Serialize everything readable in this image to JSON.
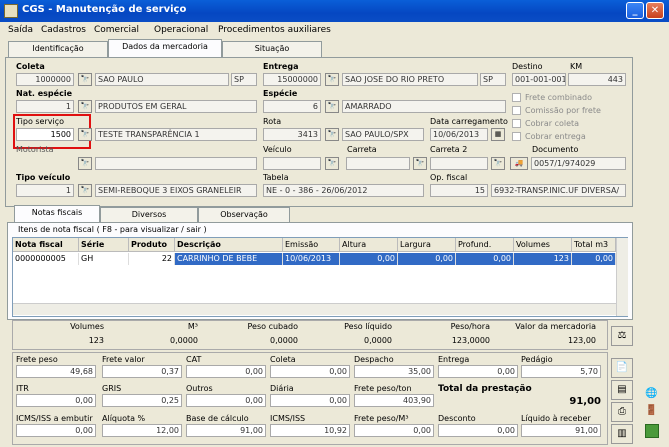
{
  "window": {
    "title": "CGS - Manutenção de serviço"
  },
  "menu": [
    "Saída",
    "Cadastros",
    "Comercial",
    "Operacional",
    "Procedimentos auxiliares"
  ],
  "top_tabs": [
    "Identificação",
    "Dados da mercadoria",
    "Situação"
  ],
  "top_tab_selected": "Dados da mercadoria",
  "coleta": {
    "label": "Coleta",
    "code": "1000000",
    "city": "SAO PAULO",
    "uf": "SP"
  },
  "entrega": {
    "label": "Entrega",
    "code": "15000000",
    "city": "SAO JOSE DO RIO PRETO",
    "uf": "SP"
  },
  "destino": {
    "label": "Destino",
    "value": "001-001-001"
  },
  "km": {
    "label": "KM",
    "value": "443"
  },
  "nat_especie": {
    "label": "Nat. espécie",
    "code": "1",
    "desc": "PRODUTOS EM GERAL"
  },
  "especie": {
    "label": "Espécie",
    "code": "6",
    "desc": "AMARRADO"
  },
  "checkboxes": [
    "Frete combinado",
    "Comissão por frete",
    "Cobrar coleta",
    "Cobrar entrega"
  ],
  "tipo_servico": {
    "label": "Tipo serviço",
    "code": "1500",
    "desc": "TESTE TRANSPARÊNCIA 1"
  },
  "rota": {
    "label": "Rota",
    "code": "3413",
    "desc": "SAO PAULO/SPX"
  },
  "data_carregamento": {
    "label": "Data carregamento",
    "value": "10/06/2013"
  },
  "motorista": {
    "label": "Motorista"
  },
  "veiculo": {
    "label": "Veículo"
  },
  "carreta": {
    "label": "Carreta"
  },
  "carreta2": {
    "label": "Carreta 2"
  },
  "documento": {
    "label": "Documento",
    "value": "0057/1/974029"
  },
  "tipo_veiculo": {
    "label": "Tipo veículo",
    "code": "1",
    "desc": "SEMI-REBOQUE 3 EIXOS GRANELEIR"
  },
  "tabela": {
    "label": "Tabela",
    "value": "NE - 0 - 386 - 26/06/2012"
  },
  "op_fiscal": {
    "label": "Op. fiscal",
    "code": "15",
    "desc": "6932-TRANSP.INIC.UF DIVERSA/"
  },
  "bottom_tabs": [
    "Notas fiscais",
    "Diversos",
    "Observação"
  ],
  "grid_caption": "Itens de nota fiscal ( F8 - para visualizar / sair )",
  "grid_headers": [
    "Nota fiscal",
    "Série",
    "Produto",
    "Descrição",
    "Emissão",
    "Altura",
    "Largura",
    "Profund.",
    "Volumes",
    "Total m3"
  ],
  "grid_rows": [
    [
      "0000000005",
      "GH",
      "22",
      "CARRINHO DE BEBE",
      "10/06/2013",
      "0,00",
      "0,00",
      "0,00",
      "123",
      "0,00"
    ]
  ],
  "totals": {
    "labels": [
      "Volumes",
      "M³",
      "Peso cubado",
      "Peso líquido",
      "Peso/hora",
      "Valor da mercadoria"
    ],
    "values": [
      "123",
      "0,0000",
      "0,0000",
      "0,0000",
      "123,0000",
      "123,00"
    ]
  },
  "freight": {
    "row1": [
      [
        "Frete peso",
        "49,68"
      ],
      [
        "Frete valor",
        "0,37"
      ],
      [
        "CAT",
        "0,00"
      ],
      [
        "Coleta",
        "0,00"
      ],
      [
        "Despacho",
        "35,00"
      ],
      [
        "Entrega",
        "0,00"
      ],
      [
        "Pedágio",
        "5,70"
      ]
    ],
    "row2": [
      [
        "ITR",
        "0,00"
      ],
      [
        "GRIS",
        "0,25"
      ],
      [
        "Outros",
        "0,00"
      ],
      [
        "Diária",
        "0,00"
      ],
      [
        "Frete peso/ton",
        "403,90"
      ]
    ],
    "total_label": "Total da prestação",
    "total_value": "91,00",
    "row3": [
      [
        "ICMS/ISS a embutir",
        "0,00"
      ],
      [
        "Alíquota %",
        "12,00"
      ],
      [
        "Base de cálculo",
        "91,00"
      ],
      [
        "ICMS/ISS",
        "10,92"
      ],
      [
        "Frete peso/M³",
        "0,00"
      ],
      [
        "Desconto",
        "0,00"
      ],
      [
        "Líquido à receber",
        "91,00"
      ]
    ]
  }
}
